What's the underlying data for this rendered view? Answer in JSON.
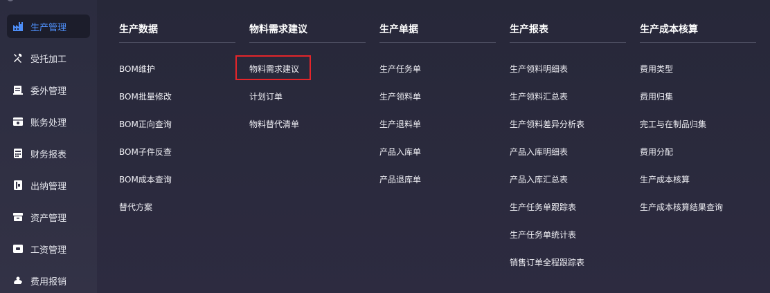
{
  "sidebar": {
    "items": [
      {
        "label": "生产管理",
        "icon": "factory-icon",
        "active": true
      },
      {
        "label": "受托加工",
        "icon": "tools-icon",
        "active": false
      },
      {
        "label": "委外管理",
        "icon": "outsource-icon",
        "active": false
      },
      {
        "label": "账务处理",
        "icon": "ledger-icon",
        "active": false
      },
      {
        "label": "财务报表",
        "icon": "report-icon",
        "active": false
      },
      {
        "label": "出纳管理",
        "icon": "cashier-icon",
        "active": false
      },
      {
        "label": "资产管理",
        "icon": "asset-icon",
        "active": false
      },
      {
        "label": "工资管理",
        "icon": "salary-icon",
        "active": false
      },
      {
        "label": "费用报销",
        "icon": "expense-icon",
        "active": false
      }
    ]
  },
  "menu": {
    "columns": [
      {
        "header": "生产数据",
        "items": [
          "BOM维护",
          "BOM批量修改",
          "BOM正向查询",
          "BOM子件反查",
          "BOM成本查询",
          "替代方案"
        ]
      },
      {
        "header": "物料需求建议",
        "items": [
          "物料需求建议",
          "计划订单",
          "物料替代清单"
        ]
      },
      {
        "header": "生产单据",
        "items": [
          "生产任务单",
          "生产领料单",
          "生产退料单",
          "产品入库单",
          "产品退库单"
        ]
      },
      {
        "header": "生产报表",
        "items": [
          "生产领料明细表",
          "生产领料汇总表",
          "生产领料差异分析表",
          "产品入库明细表",
          "产品入库汇总表",
          "生产任务单跟踪表",
          "生产任务单统计表",
          "销售订单全程跟踪表"
        ]
      },
      {
        "header": "生产成本核算",
        "items": [
          "费用类型",
          "费用归集",
          "完工与在制品归集",
          "费用分配",
          "生产成本核算",
          "生产成本核算结果查询"
        ]
      }
    ],
    "highlighted": "物料需求建议"
  },
  "colors": {
    "accent": "#4d8df6",
    "highlight_border": "#e5252a",
    "sidebar_bg": "#2b2c3f",
    "panel_bg": "#272839"
  }
}
